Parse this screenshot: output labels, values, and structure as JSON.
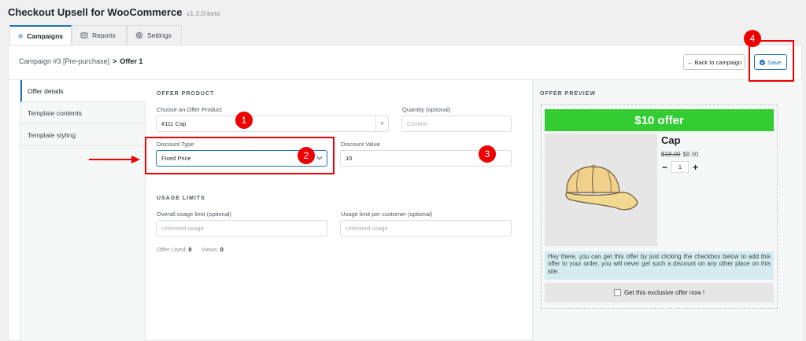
{
  "header": {
    "title": "Checkout Upsell for WooCommerce",
    "version": "v1.3.0-beta"
  },
  "tabs": [
    {
      "label": "Campaigns",
      "icon": "layers-icon",
      "active": true
    },
    {
      "label": "Reports",
      "icon": "reports-icon",
      "active": false
    },
    {
      "label": "Settings",
      "icon": "gear-icon",
      "active": false
    }
  ],
  "breadcrumb": {
    "campaign": "Campaign #3 [Pre-purchase]",
    "separator": ">",
    "current": "Offer 1"
  },
  "actions": {
    "back_label": "Back to campaign",
    "save_label": "Save"
  },
  "sidebar": {
    "items": [
      {
        "label": "Offer details"
      },
      {
        "label": "Template contents"
      },
      {
        "label": "Template styling"
      }
    ]
  },
  "offer_product": {
    "heading": "OFFER PRODUCT",
    "product_label": "Choose an Offer Product",
    "product_value": "#111 Cap",
    "quantity_label": "Quantity (optional)",
    "quantity_placeholder": "Custom",
    "discount_type_label": "Discount Type",
    "discount_type_value": "Fixed Price",
    "discount_value_label": "Discount Value",
    "discount_value": "10"
  },
  "usage_limits": {
    "heading": "USAGE LIMITS",
    "overall_label": "Overall usage limit (optional)",
    "overall_placeholder": "Unlimited usage",
    "per_customer_label": "Usage limit per customer (optional)",
    "per_customer_placeholder": "Unlimited usage",
    "offer_used_label": "Offer Used:",
    "offer_used_value": "0",
    "views_label": "Views:",
    "views_value": "0"
  },
  "preview": {
    "heading": "OFFER PREVIEW",
    "offer_title": "$10 offer",
    "product_name": "Cap",
    "regular_price": "$18.00",
    "sale_price": "$8.00",
    "quantity": "1",
    "minus": "−",
    "plus": "+",
    "description": "Hey there, you can get this offer by just clicking the checkbox below to add this offer to your order, you will never get such a discount on any other place on this site.",
    "cta_label": "Get this exclusive offer now !"
  },
  "annotations": {
    "badges": [
      "1",
      "2",
      "3",
      "4"
    ]
  },
  "colors": {
    "accent": "#2271b1",
    "offer_green": "#33cc33",
    "annotation_red": "#ee0000",
    "description_bg": "#d4ecef"
  }
}
